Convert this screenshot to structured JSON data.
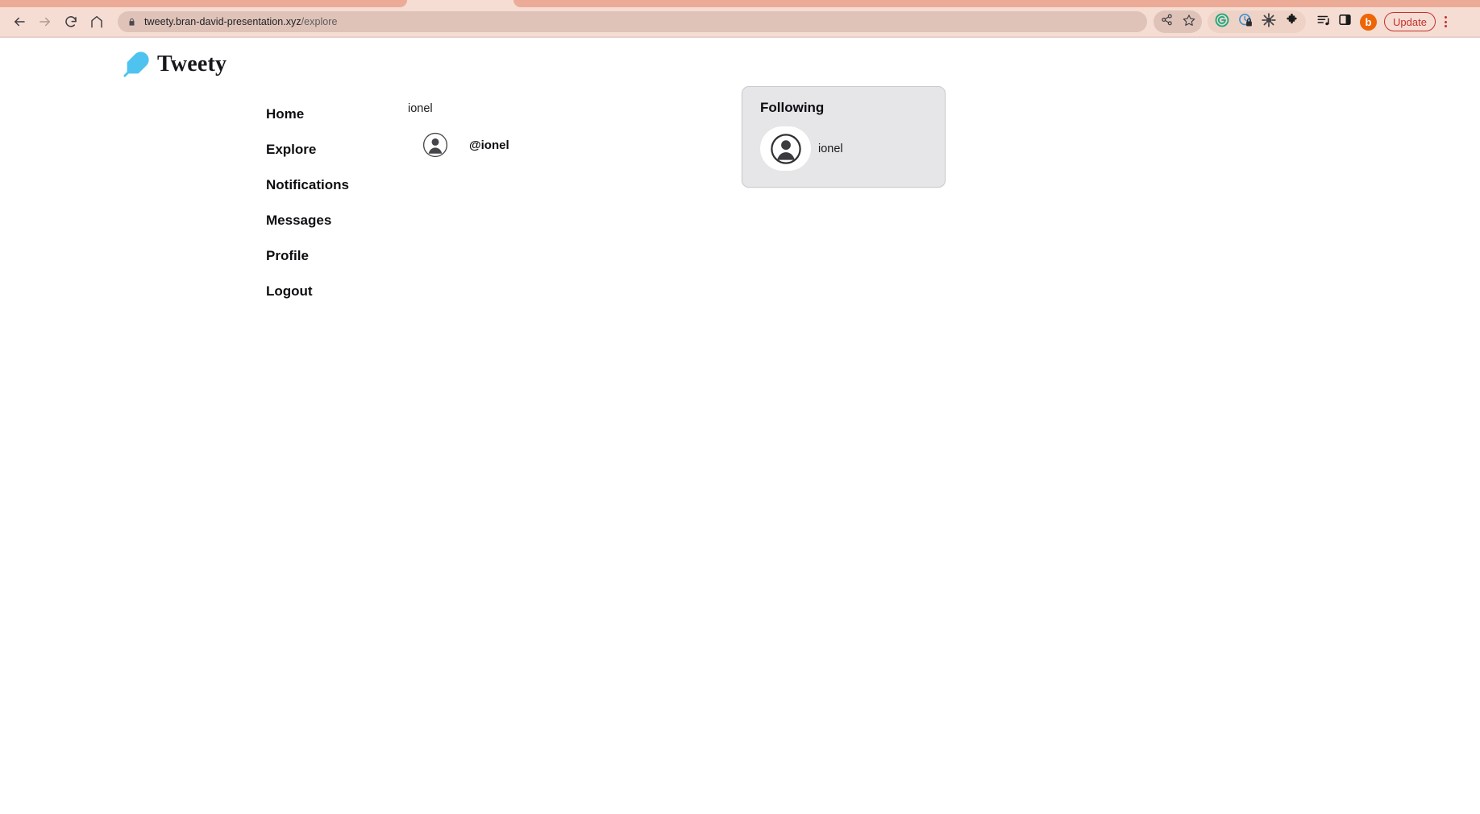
{
  "browser": {
    "back_icon": "back-arrow-icon",
    "forward_icon": "forward-arrow-icon",
    "reload_icon": "reload-icon",
    "home_icon": "home-icon",
    "lock_icon": "lock-icon",
    "url_domain": "tweety.bran-david-presentation.xyz",
    "url_path": "/explore",
    "url_full": "tweety.bran-david-presentation.xyz/explore",
    "share_icon": "share-icon",
    "bookmark_icon": "star-icon",
    "extensions": [
      {
        "name": "grammarly-extension-icon",
        "color": "#15a97f",
        "letter": "G"
      },
      {
        "name": "password-manager-extension-icon",
        "color": "#3b8fd4",
        "letter": ""
      },
      {
        "name": "bug-extension-icon",
        "color": "#444444",
        "letter": ""
      },
      {
        "name": "puzzle-extensions-icon",
        "color": "#1b1b1b",
        "letter": ""
      }
    ],
    "reading_list_icon": "reading-list-icon",
    "side_panel_icon": "side-panel-icon",
    "profile_letter": "b",
    "profile_color": "#ec6608",
    "update_label": "Update",
    "update_color": "#c5302b",
    "menu_icon": "kebab-menu-icon",
    "toolbar_bg": "#f6ddd4",
    "omnibox_bg": "#dfc3b9"
  },
  "site": {
    "logo_icon": "feather-icon",
    "logo_color": "#4ec3f0",
    "title": "Tweety"
  },
  "sidebar": {
    "items": [
      {
        "label": "Home",
        "name": "sidebar-item-home"
      },
      {
        "label": "Explore",
        "name": "sidebar-item-explore"
      },
      {
        "label": "Notifications",
        "name": "sidebar-item-notifications"
      },
      {
        "label": "Messages",
        "name": "sidebar-item-messages"
      },
      {
        "label": "Profile",
        "name": "sidebar-item-profile"
      },
      {
        "label": "Logout",
        "name": "sidebar-item-logout"
      }
    ]
  },
  "main": {
    "search_query": "ionel",
    "results": [
      {
        "avatar_icon": "user-avatar-icon",
        "handle": "@ionel"
      }
    ]
  },
  "following_panel": {
    "title": "Following",
    "card_bg": "#e6e6e9",
    "users": [
      {
        "avatar_icon": "user-avatar-icon",
        "name": "ionel"
      }
    ]
  }
}
